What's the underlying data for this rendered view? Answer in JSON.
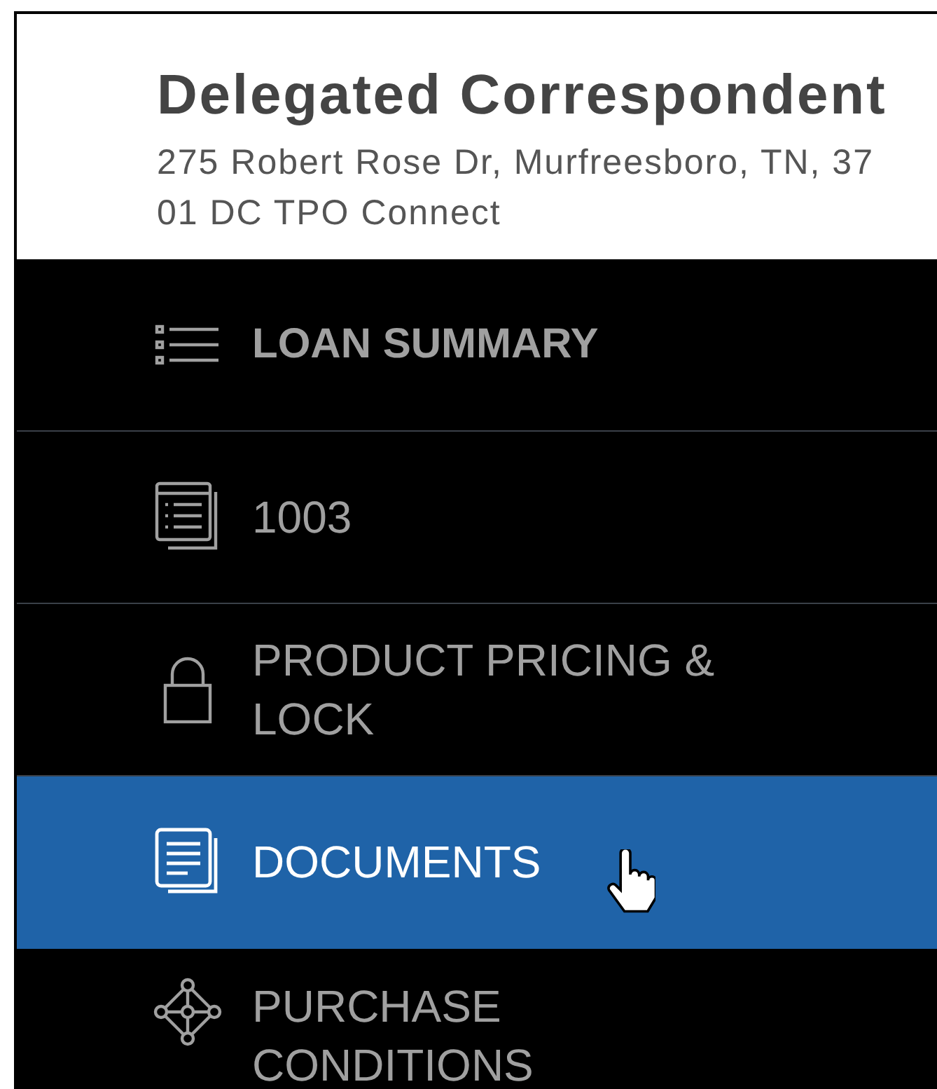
{
  "header": {
    "title": "Delegated Correspondent",
    "address": "275 Robert Rose Dr, Murfreesboro, TN, 37",
    "subtitle": "01 DC TPO Connect"
  },
  "nav": [
    {
      "kind": "summary",
      "label": "LOAN SUMMARY",
      "selected": false,
      "bold": true,
      "hovered": false
    },
    {
      "kind": "form",
      "label": "1003",
      "selected": false,
      "bold": false,
      "hovered": false
    },
    {
      "kind": "lock",
      "label": "PRODUCT PRICING & LOCK",
      "selected": false,
      "bold": false,
      "hovered": false
    },
    {
      "kind": "documents",
      "label": "DOCUMENTS",
      "selected": true,
      "bold": false,
      "hovered": true
    },
    {
      "kind": "conditions",
      "label": "PURCHASE CONDITIONS",
      "selected": false,
      "bold": false,
      "hovered": false
    }
  ]
}
